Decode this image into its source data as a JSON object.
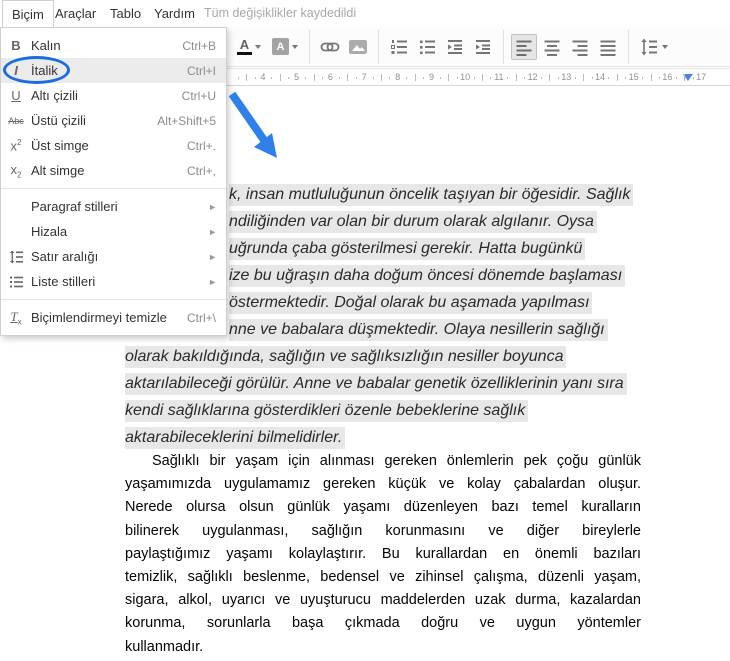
{
  "menubar": {
    "items": [
      "Biçim",
      "Araçlar",
      "Tablo",
      "Yardım"
    ],
    "status": "Tüm değişiklikler kaydedildi"
  },
  "format_menu": {
    "items": [
      {
        "icon": "bold-icon",
        "label": "Kalın",
        "shortcut": "Ctrl+B"
      },
      {
        "icon": "italic-icon",
        "label": "İtalik",
        "shortcut": "Ctrl+I",
        "highlighted": true,
        "annotated": "blue-ellipse"
      },
      {
        "icon": "underline-icon",
        "label": "Altı çizili",
        "shortcut": "Ctrl+U"
      },
      {
        "icon": "strikethrough-icon",
        "label": "Üstü çizili",
        "shortcut": "Alt+Shift+5"
      },
      {
        "icon": "superscript-icon",
        "label": "Üst simge",
        "shortcut": "Ctrl+."
      },
      {
        "icon": "subscript-icon",
        "label": "Alt simge",
        "shortcut": "Ctrl+,"
      },
      {
        "icon": "none",
        "label": "Paragraf stilleri",
        "submenu": "►"
      },
      {
        "icon": "none",
        "label": "Hizala",
        "submenu": "►"
      },
      {
        "icon": "line-spacing-icon",
        "label": "Satır aralığı",
        "submenu": "►"
      },
      {
        "icon": "list-styles-icon",
        "label": "Liste stilleri",
        "submenu": "►"
      },
      {
        "icon": "clear-formatting-icon",
        "label": "Biçimlendirmeyi temizle",
        "shortcut": "Ctrl+\\"
      }
    ]
  },
  "toolbar": {
    "buttons": [
      "text-color",
      "highlight-color",
      "insert-link",
      "insert-image",
      "numbered-list",
      "bulleted-list",
      "decrease-indent",
      "increase-indent",
      "align-left",
      "align-center",
      "align-right",
      "justify",
      "line-spacing"
    ],
    "active_button": "align-left",
    "text_color_letter": "A",
    "highlight_letter": "A"
  },
  "ruler": {
    "numbers": [
      4,
      5,
      6,
      7,
      8,
      9,
      10,
      11,
      12,
      13,
      14,
      15,
      16,
      17
    ],
    "marker": "right-indent-marker"
  },
  "document": {
    "paragraph1": {
      "style": "italic, gray-highlighted",
      "lines": [
        "k, insan mutluluğunun öncelik taşıyan bir öğesidir. Sağlık",
        "ndiliğinden var olan bir durum olarak algılanır. Oysa",
        "uğrunda çaba gösterilmesi gerekir. Hatta bugünkü",
        "ize bu uğraşın daha doğum öncesi dönemde başlaması",
        "östermektedir. Doğal olarak bu aşamada yapılması",
        "nne ve babalara düşmektedir. Olaya nesillerin sağlığı",
        "olarak bakıldığında, sağlığın ve sağlıksızlığın nesiller boyunca",
        "aktarılabileceği görülür. Anne ve babalar genetik özelliklerinin yanı sıra",
        "kendi sağlıklarına gösterdikleri özenle bebeklerine sağlık",
        "aktarabileceklerini bilmelidirler."
      ]
    },
    "paragraph2": {
      "style": "justified",
      "lines": [
        "Sağlıklı bir yaşam için alınması gereken önlemlerin pek çoğu günlük",
        "yaşamımızda  uygulamamız gereken küçük ve kolay çabalardan oluşur.",
        "Nerede olursa olsun günlük yaşamı düzenleyen bazı temel kuralların",
        "bilinerek uygulanması, sağlığın korunmasını ve diğer bireylerle",
        "paylaştığımız yaşamı kolaylaştırır. Bu kurallardan en önemli bazıları",
        "temizlik, sağlıklı beslenme, bedensel ve zihinsel çalışma, düzenli yaşam,",
        "sigara, alkol, uyarıcı ve uyuşturucu maddelerden uzak durma, kazalardan",
        "korunma, sorunlarla başa çıkmada doğru ve uygun yöntemler",
        "kullanmadır."
      ]
    }
  },
  "annotations": {
    "ellipse_target": "İtalik menu item",
    "ellipse_color": "#1b6ce0",
    "arrow_color": "#2e80ea"
  }
}
